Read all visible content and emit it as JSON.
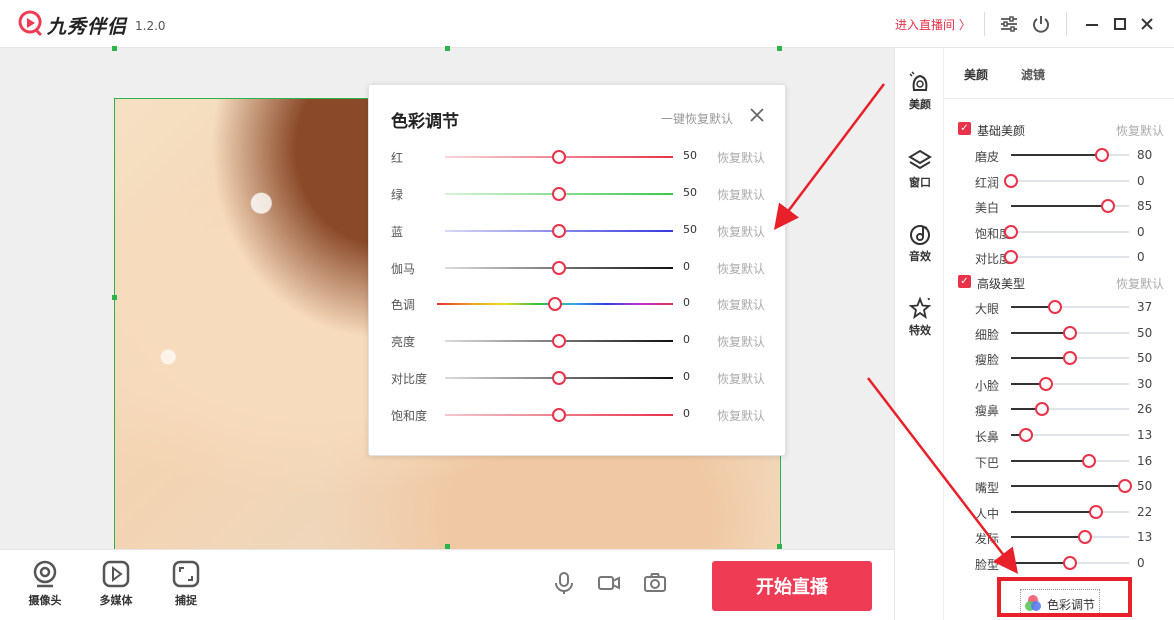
{
  "titlebar": {
    "app_name": "九秀伴侣",
    "version": "1.2.0",
    "enter_live": "进入直播间 〉",
    "icons": [
      "settings-sliders-icon",
      "power-icon",
      "minimize-icon",
      "maximize-icon",
      "close-icon"
    ]
  },
  "color_dialog": {
    "title": "色彩调节",
    "reset_all": "一键恢复默认",
    "reset_label": "恢复默认",
    "rows": [
      {
        "label": "红",
        "value": "50",
        "level": 0.5
      },
      {
        "label": "绿",
        "value": "50",
        "level": 0.5
      },
      {
        "label": "蓝",
        "value": "50",
        "level": 0.5
      },
      {
        "label": "伽马",
        "value": "0",
        "level": 0.5
      },
      {
        "label": "色调",
        "value": "0",
        "level": 0.5
      },
      {
        "label": "亮度",
        "value": "0",
        "level": 0.5
      },
      {
        "label": "对比度",
        "value": "0",
        "level": 0.5
      },
      {
        "label": "饱和度",
        "value": "0",
        "level": 0.5
      }
    ],
    "track_colors": {
      "red": "#e8334a",
      "green": "#3cc84a",
      "blue": "#3a3adf"
    }
  },
  "bottombar": {
    "tools": [
      {
        "label": "摄像头",
        "icon": "webcam-icon"
      },
      {
        "label": "多媒体",
        "icon": "play-icon"
      },
      {
        "label": "捕捉",
        "icon": "capture-icon"
      }
    ],
    "start_live": "开始直播"
  },
  "categories": [
    {
      "label": "美颜",
      "icon": "beauty-icon"
    },
    {
      "label": "窗口",
      "icon": "layers-icon"
    },
    {
      "label": "音效",
      "icon": "music-icon"
    },
    {
      "label": "特效",
      "icon": "sparkle-icon"
    }
  ],
  "beauty_panel": {
    "tabs": [
      "美颜",
      "滤镜"
    ],
    "basic_section": {
      "title": "基础美颜",
      "reset": "恢复默认"
    },
    "basic_rows": [
      {
        "label": "磨皮",
        "value": "80",
        "level": 0.77
      },
      {
        "label": "红润",
        "value": "0",
        "level": 0
      },
      {
        "label": "美白",
        "value": "85",
        "level": 0.82
      },
      {
        "label": "饱和度",
        "value": "0",
        "level": 0
      },
      {
        "label": "对比度",
        "value": "0",
        "level": 0
      }
    ],
    "advanced_section": {
      "title": "高级美型",
      "reset": "恢复默认"
    },
    "advanced_rows": [
      {
        "label": "大眼",
        "value": "37",
        "level": 0.37
      },
      {
        "label": "细脸",
        "value": "50",
        "level": 0.5
      },
      {
        "label": "瘦脸",
        "value": "50",
        "level": 0.5
      },
      {
        "label": "小脸",
        "value": "30",
        "level": 0.3
      },
      {
        "label": "瘦鼻",
        "value": "26",
        "level": 0.26
      },
      {
        "label": "长鼻",
        "value": "13",
        "level": 0.13
      },
      {
        "label": "下巴",
        "value": "16",
        "level": 0.66
      },
      {
        "label": "嘴型",
        "value": "50",
        "level": 0.97
      },
      {
        "label": "人中",
        "value": "22",
        "level": 0.72
      },
      {
        "label": "发际",
        "value": "13",
        "level": 0.63
      },
      {
        "label": "脸型",
        "value": "0",
        "level": 0.5
      }
    ],
    "color_adjust_button": "色彩调节"
  }
}
